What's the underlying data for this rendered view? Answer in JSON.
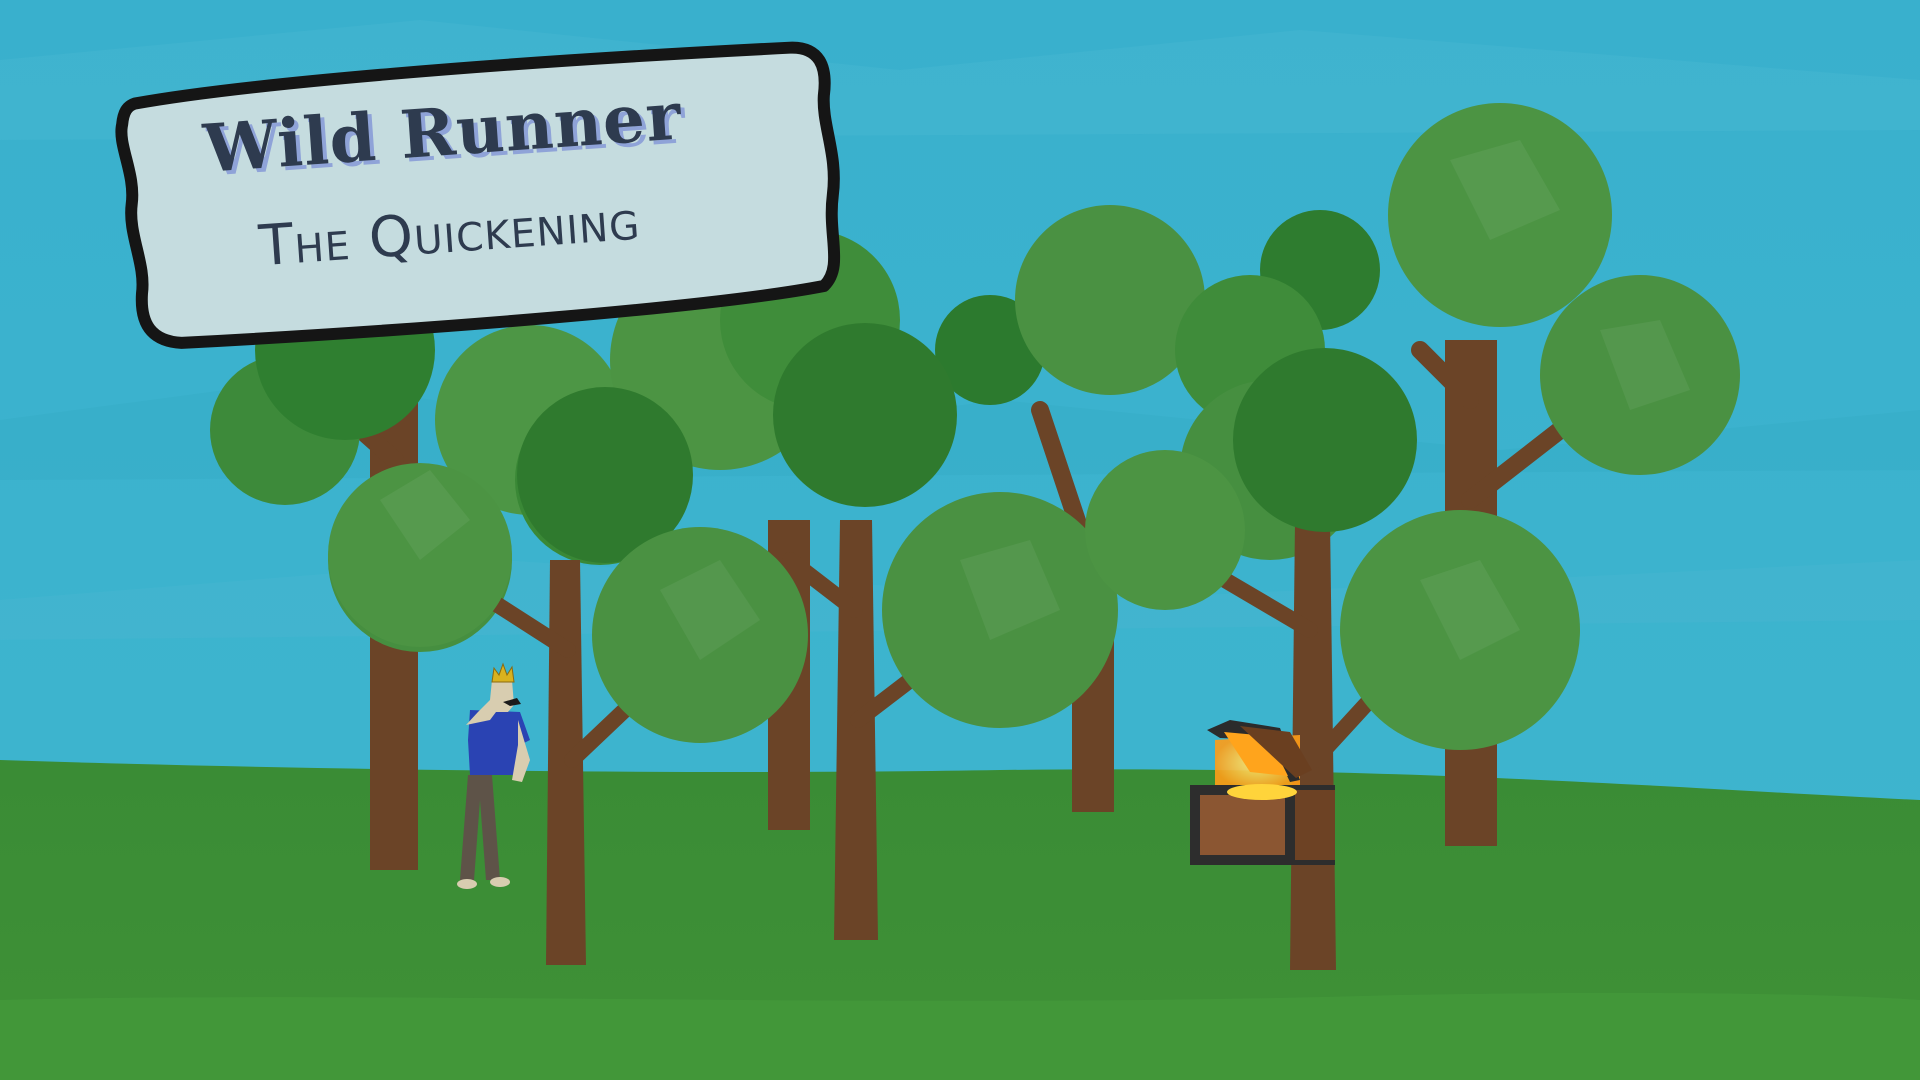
{
  "title": {
    "main": "Wild Runner",
    "subtitle": "The Quickening"
  },
  "colors": {
    "sky": "#3cb3cf",
    "ground": "#3c8d36",
    "foliage_light": "#4a9142",
    "foliage_dark": "#2f7a2e",
    "trunk": "#6b4427",
    "sign_board": "#c5dcdf",
    "sign_border": "#151515",
    "title_text": "#2e3b4f",
    "title_shadow": "#8fa3d8",
    "chest_gold": "#ffb321"
  },
  "scene": {
    "character": {
      "headwear": "crown-icon",
      "shirt_color": "#2a43b3"
    },
    "treasure_chest": {
      "state": "open",
      "contents": "gold"
    }
  }
}
